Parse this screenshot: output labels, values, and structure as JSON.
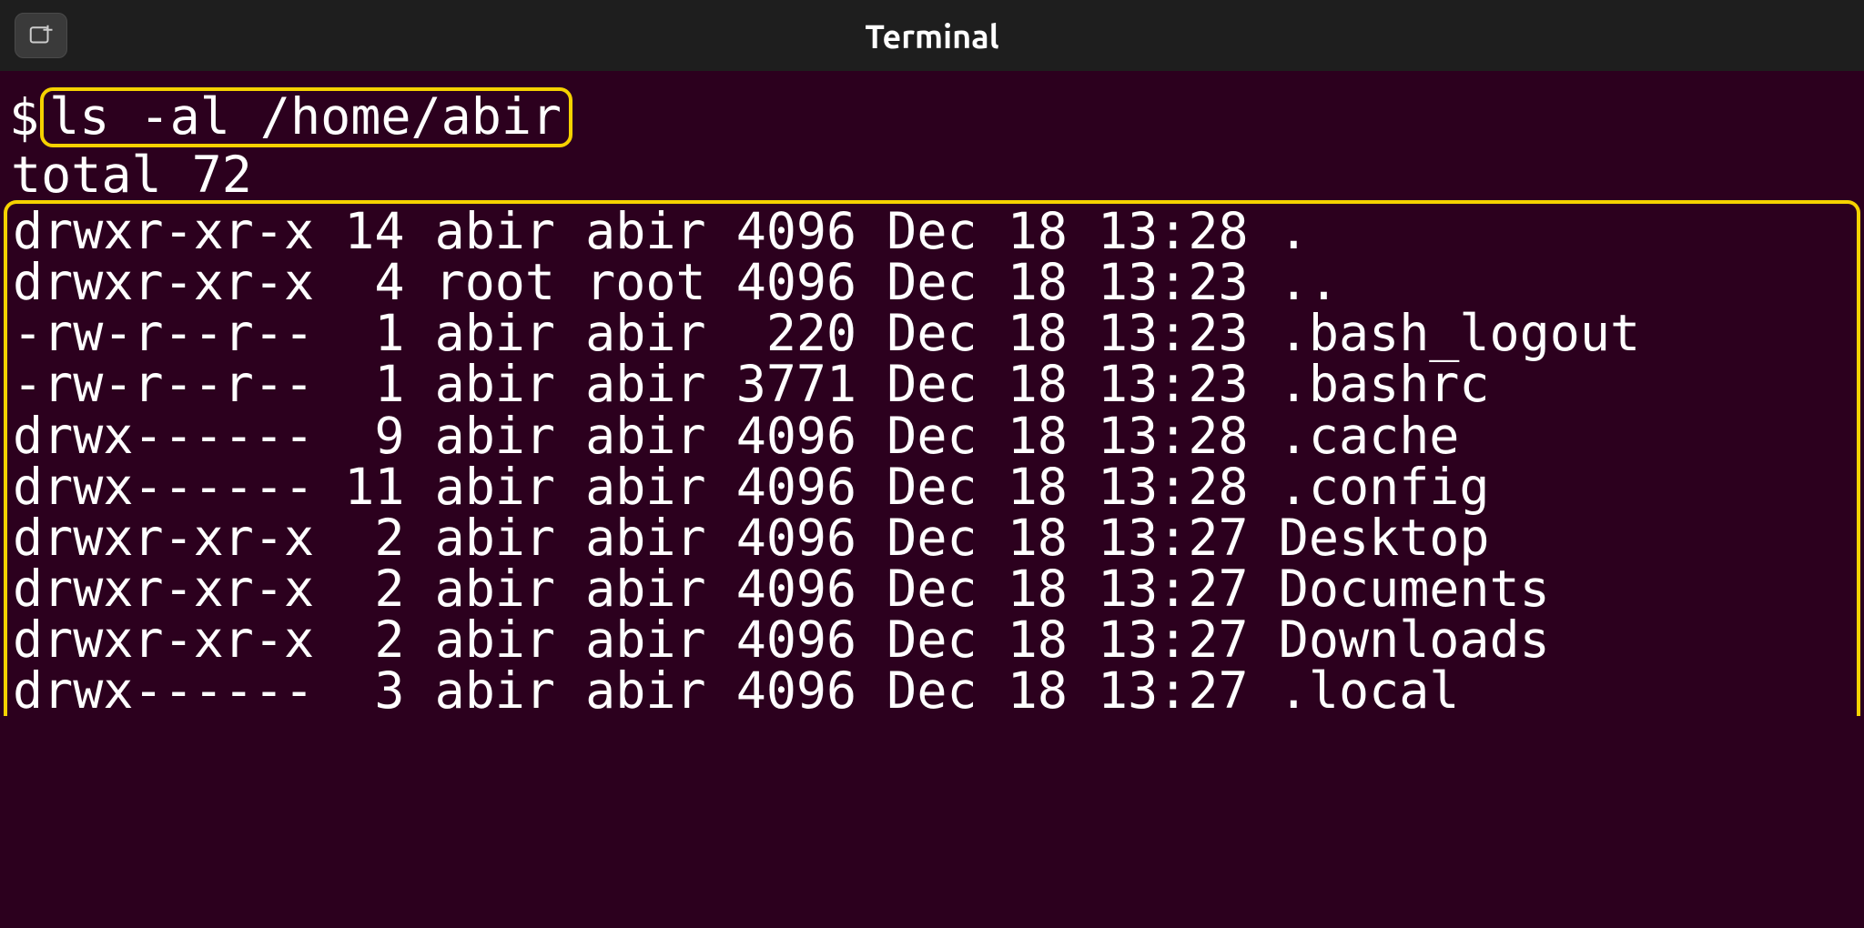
{
  "header": {
    "title": "Terminal"
  },
  "terminal": {
    "prompt": "$",
    "command": "ls -al /home/abir",
    "total_line": "total 72",
    "rows": [
      "drwxr-xr-x 14 abir abir 4096 Dec 18 13:28 .",
      "drwxr-xr-x  4 root root 4096 Dec 18 13:23 ..",
      "-rw-r--r--  1 abir abir  220 Dec 18 13:23 .bash_logout",
      "-rw-r--r--  1 abir abir 3771 Dec 18 13:23 .bashrc",
      "drwx------  9 abir abir 4096 Dec 18 13:28 .cache",
      "drwx------ 11 abir abir 4096 Dec 18 13:28 .config",
      "drwxr-xr-x  2 abir abir 4096 Dec 18 13:27 Desktop",
      "drwxr-xr-x  2 abir abir 4096 Dec 18 13:27 Documents",
      "drwxr-xr-x  2 abir abir 4096 Dec 18 13:27 Downloads",
      "drwx------  3 abir abir 4096 Dec 18 13:27 .local"
    ]
  }
}
